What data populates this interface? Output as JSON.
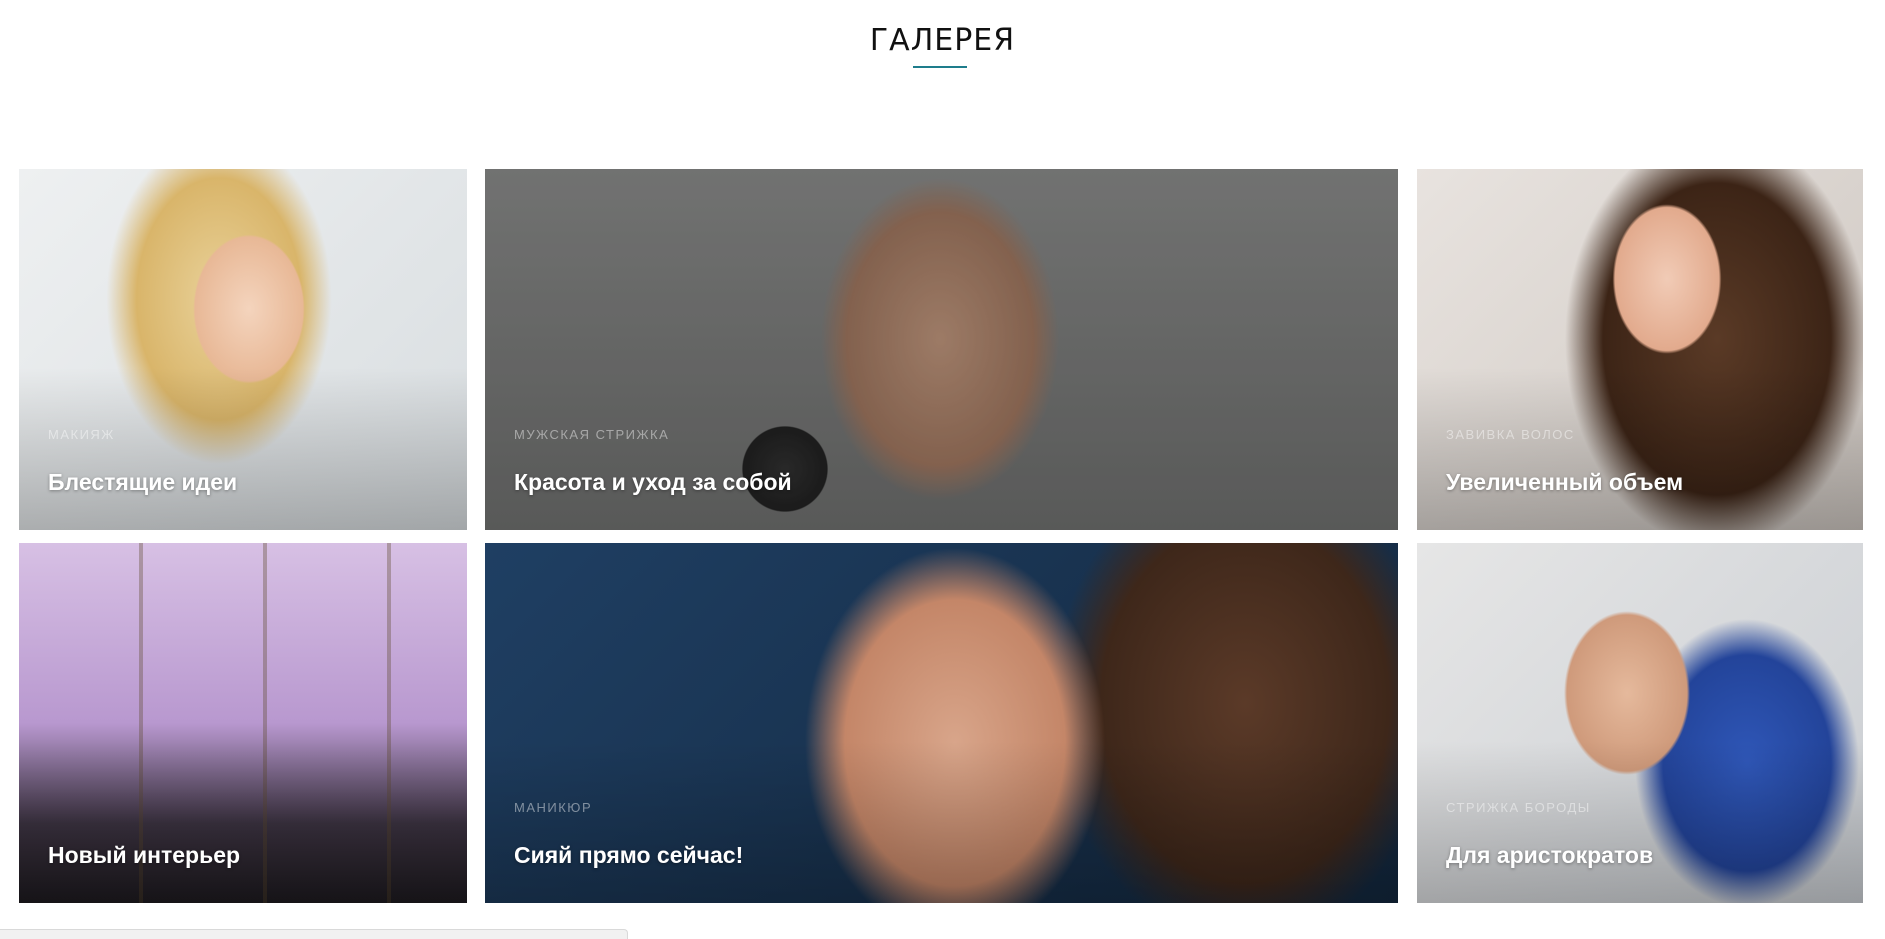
{
  "section": {
    "title": "ГАЛЕРЕЯ"
  },
  "gallery": {
    "items": [
      {
        "category": "Макияж",
        "title": "Блестящие идеи"
      },
      {
        "category": "Мужская стрижка",
        "title": "Красота и уход за собой"
      },
      {
        "category": "Завивка волос",
        "title": "Увеличенный объем"
      },
      {
        "category": "",
        "title": "Новый интерьер"
      },
      {
        "category": "Маникюр",
        "title": "Сияй прямо сейчас!"
      },
      {
        "category": "Стрижка бороды",
        "title": "Для аристократов"
      }
    ]
  },
  "colors": {
    "accent": "#1e7d8c"
  }
}
